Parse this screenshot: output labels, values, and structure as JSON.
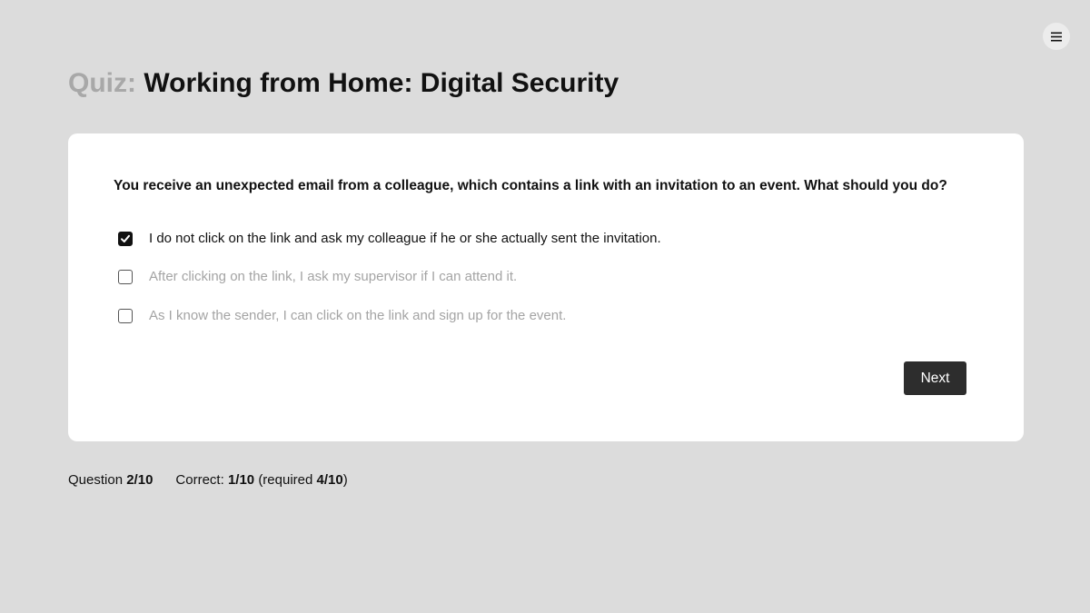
{
  "header": {
    "title_prefix": "Quiz:",
    "title": "Working from Home: Digital Security",
    "menu_icon": "hamburger-menu-icon"
  },
  "quiz": {
    "question": "You receive an unexpected email from a colleague, which contains a link with an invitation to an event. What should you do?",
    "options": [
      {
        "label": "I do not click on the link and ask my colleague if he or she actually sent the invitation.",
        "checked": true
      },
      {
        "label": "After clicking on the link, I ask my supervisor if I can attend it.",
        "checked": false
      },
      {
        "label": "As I know the sender, I can click on the link and sign up for the event.",
        "checked": false
      }
    ],
    "next_label": "Next"
  },
  "footer": {
    "question_label": "Question",
    "question_value": "2/10",
    "correct_label": "Correct:",
    "correct_value": "1/10",
    "required_prefix": "(required",
    "required_value": "4/10",
    "required_suffix": ")"
  },
  "colors": {
    "background": "#dcdcdc",
    "card": "#ffffff",
    "title_prefix": "#a8a8a8",
    "button": "#2d2d2d",
    "inactive_text": "#a4a4a4"
  }
}
